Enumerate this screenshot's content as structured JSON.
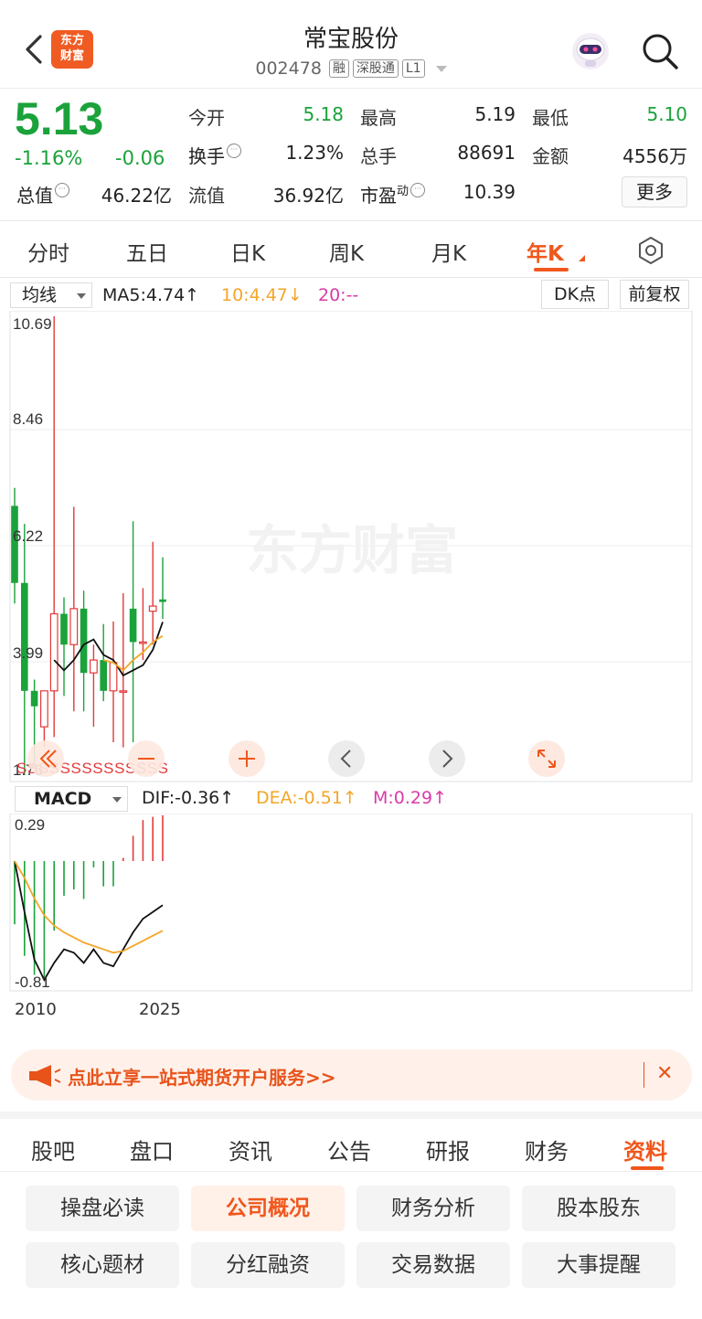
{
  "header": {
    "logo_line1": "东方",
    "logo_line2": "财富",
    "stock_name": "常宝股份",
    "stock_code": "002478",
    "tags": [
      "融",
      "深股通",
      "L1"
    ]
  },
  "quote": {
    "price": "5.13",
    "change_pct": "-1.16%",
    "change_abs": "-0.06",
    "fields": [
      {
        "label": "今开",
        "value": "5.18",
        "color": "green"
      },
      {
        "label": "最高",
        "value": "5.19",
        "color": "black"
      },
      {
        "label": "最低",
        "value": "5.10",
        "color": "green"
      },
      {
        "label": "换手",
        "value": "1.23%",
        "color": "black"
      },
      {
        "label": "总手",
        "value": "88691",
        "color": "black"
      },
      {
        "label": "金额",
        "value": "4556万",
        "color": "black"
      },
      {
        "label": "总值",
        "value": "46.22亿",
        "color": "black"
      },
      {
        "label": "流值",
        "value": "36.92亿",
        "color": "black"
      },
      {
        "label": "市盈",
        "label_sup": "动",
        "value": "10.39",
        "color": "black"
      }
    ],
    "more_label": "更多"
  },
  "period_tabs": [
    "分时",
    "五日",
    "日K",
    "周K",
    "月K",
    "年K"
  ],
  "active_period": "年K",
  "ma_legend": {
    "selector": "均线",
    "ma5": "MA5:4.74↑",
    "ma10": "10:4.47↓",
    "ma20": "20:--",
    "dk_label": "DK点",
    "adjust_label": "前复权"
  },
  "chart_labels": {
    "y_top": "10.69",
    "y2": "8.46",
    "y3": "6.22",
    "y4": "3.99",
    "y_bottom": "1.76",
    "watermark": "东方财富",
    "s_marks": "SSSSSSSSSSSSSS"
  },
  "macd_legend": {
    "selector": "MACD",
    "dif": "DIF:-0.36↑",
    "dea": "DEA:-0.51↑",
    "m": "M:0.29↑",
    "y_top": "0.29",
    "y_bottom": "-0.81"
  },
  "x_axis": {
    "start": "2010",
    "end": "2025"
  },
  "colors": {
    "up": "#e23a3a",
    "down": "#1ba23b",
    "accent": "#f0571c",
    "ma10": "#f3a629",
    "ma20": "#d83ca8"
  },
  "chart_data": {
    "type": "candlestick",
    "x": [
      "2010",
      "2011",
      "2012",
      "2013",
      "2014",
      "2015",
      "2016",
      "2017",
      "2018",
      "2019",
      "2020",
      "2021",
      "2022",
      "2023",
      "2024",
      "2025"
    ],
    "open": [
      7.0,
      5.5,
      3.4,
      2.7,
      3.4,
      4.9,
      4.3,
      5.0,
      3.75,
      4.0,
      3.4,
      3.4,
      5.0,
      4.35,
      4.95,
      5.18
    ],
    "high": [
      7.35,
      6.65,
      3.62,
      3.33,
      10.69,
      5.22,
      6.98,
      5.35,
      4.3,
      4.7,
      4.75,
      5.3,
      6.7,
      5.4,
      6.3,
      6.0
    ],
    "low": [
      5.1,
      1.76,
      1.9,
      2.3,
      2.5,
      3.3,
      3.0,
      3.0,
      2.7,
      3.2,
      2.4,
      2.3,
      2.4,
      4.0,
      4.3,
      4.8
    ],
    "close": [
      5.5,
      3.4,
      3.1,
      3.4,
      4.9,
      4.3,
      5.0,
      3.75,
      4.0,
      3.4,
      3.95,
      3.4,
      4.35,
      4.35,
      5.05,
      5.13
    ],
    "ma5": [
      null,
      null,
      null,
      null,
      4.0,
      3.8,
      4.0,
      4.3,
      4.4,
      4.1,
      4.0,
      3.7,
      3.8,
      3.9,
      4.2,
      4.74
    ],
    "ma10": [
      null,
      null,
      null,
      null,
      null,
      null,
      null,
      null,
      null,
      4.0,
      3.95,
      3.8,
      4.0,
      4.15,
      4.35,
      4.47
    ],
    "macd_dif": [
      -0.1,
      -0.4,
      -0.68,
      -0.8,
      -0.7,
      -0.62,
      -0.64,
      -0.7,
      -0.62,
      -0.7,
      -0.72,
      -0.62,
      -0.52,
      -0.44,
      -0.4,
      -0.36
    ],
    "macd_dea": [
      -0.1,
      -0.2,
      -0.32,
      -0.42,
      -0.48,
      -0.52,
      -0.55,
      -0.58,
      -0.6,
      -0.62,
      -0.64,
      -0.63,
      -0.6,
      -0.57,
      -0.54,
      -0.51
    ],
    "macd_m": [
      -0.4,
      -0.6,
      -0.72,
      -0.76,
      -0.44,
      -0.22,
      -0.18,
      -0.24,
      -0.04,
      -0.16,
      -0.16,
      0.02,
      0.16,
      0.26,
      0.28,
      0.29
    ],
    "ylim": [
      1.76,
      10.69
    ],
    "macd_ylim": [
      -0.81,
      0.29
    ],
    "grid": true
  },
  "promo": {
    "text": "点此立享一站式期货开户服务>>",
    "close": "✕"
  },
  "bottom_tabs": [
    "股吧",
    "盘口",
    "资讯",
    "公告",
    "研报",
    "财务",
    "资料"
  ],
  "active_bottom_tab": "资料",
  "grid_buttons": [
    "操盘必读",
    "公司概况",
    "财务分析",
    "股本股东",
    "核心题材",
    "分红融资",
    "交易数据",
    "大事提醒"
  ],
  "active_grid_button": "公司概况"
}
